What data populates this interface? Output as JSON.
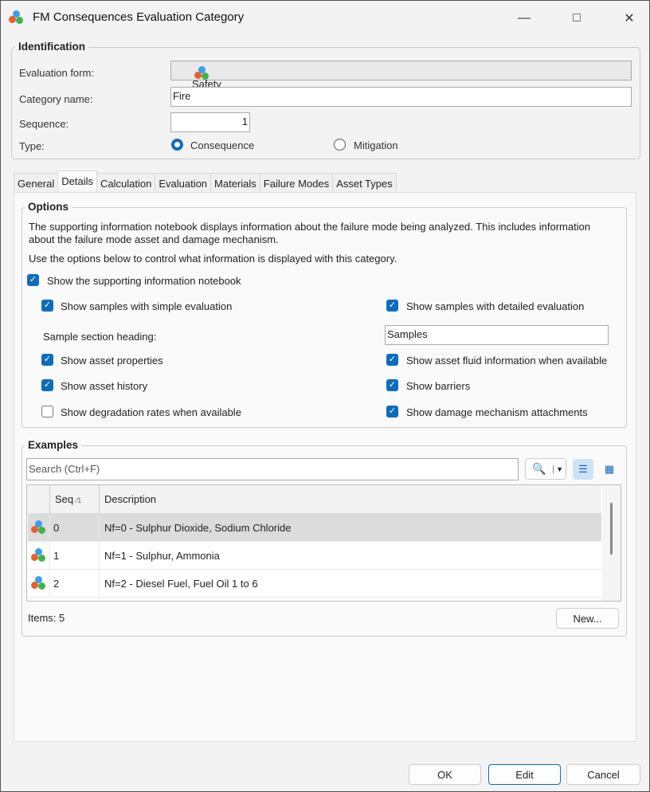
{
  "window": {
    "title": "FM Consequences Evaluation Category"
  },
  "identification": {
    "legend": "Identification",
    "evaluation_form_label": "Evaluation form:",
    "evaluation_form_value": "Safety",
    "category_name_label": "Category name:",
    "category_name_value": "Fire",
    "sequence_label": "Sequence:",
    "sequence_value": "1",
    "type_label": "Type:",
    "type_options": [
      "Consequence",
      "Mitigation"
    ],
    "type_selected": "Consequence"
  },
  "tabs": [
    "General",
    "Details",
    "Calculation",
    "Evaluation",
    "Materials",
    "Failure Modes",
    "Asset Types"
  ],
  "active_tab": "Details",
  "options": {
    "legend": "Options",
    "description": "The supporting information notebook displays information about the failure mode being analyzed.  This includes information about the failure mode asset and damage mechanism.",
    "instruction": "Use the options below to control what information is displayed with this category.",
    "show_notebook": "Show the supporting information notebook",
    "simple_eval": "Show samples with simple evaluation",
    "detailed_eval": "Show samples with detailed evaluation",
    "sample_heading_label": "Sample section heading:",
    "sample_heading_value": "Samples",
    "asset_properties": "Show asset properties",
    "fluid_info": "Show asset fluid information when available",
    "asset_history": "Show asset history",
    "barriers": "Show barriers",
    "degradation": "Show degradation rates when available",
    "attachments": "Show damage mechanism attachments"
  },
  "examples": {
    "legend": "Examples",
    "search_placeholder": "Search   (Ctrl+F)",
    "columns": [
      "Seq",
      "Description"
    ],
    "sort_indicator": "1",
    "rows": [
      {
        "seq": "0",
        "description": "Nf=0 - Sulphur Dioxide, Sodium Chloride"
      },
      {
        "seq": "1",
        "description": "Nf=1 - Sulphur, Ammonia"
      },
      {
        "seq": "2",
        "description": "Nf=2 - Diesel Fuel, Fuel Oil 1 to 6"
      }
    ],
    "items_count": "Items: 5",
    "new_button": "New..."
  },
  "footer": {
    "ok": "OK",
    "edit": "Edit",
    "cancel": "Cancel"
  }
}
